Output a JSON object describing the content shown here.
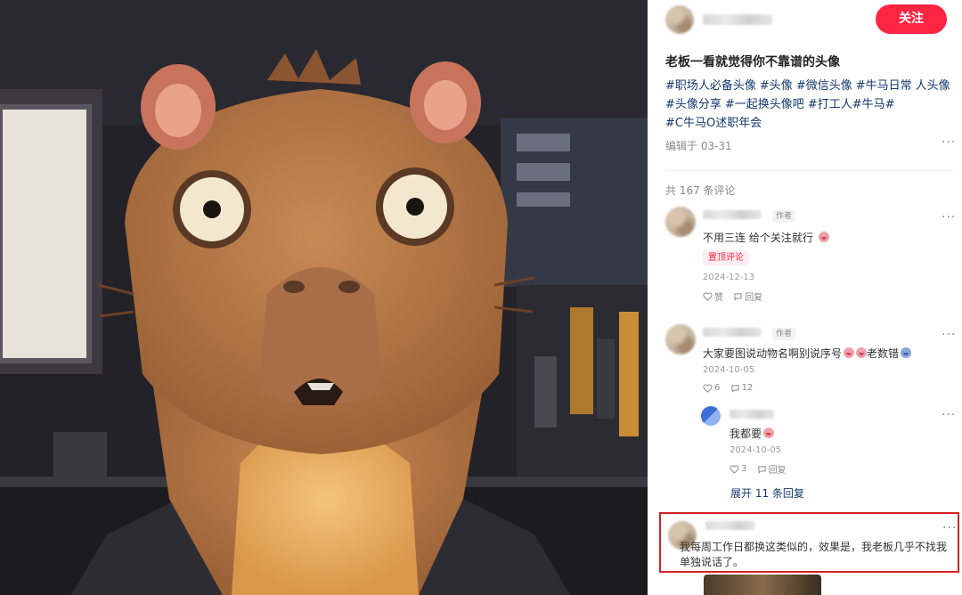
{
  "post": {
    "follow_label": "关注",
    "title": "老板一看就觉得你不靠谱的头像",
    "hashtags": [
      "#职场人必备头像",
      "#头像",
      "#微信头像",
      "#牛马日常",
      "人头像",
      "#头像分享",
      "#一起换头像吧",
      "#打工人",
      "#牛马",
      "#",
      "#C牛马O述职年会"
    ],
    "edited_at": "编辑于 03-31"
  },
  "comments": {
    "count_label": "共 167 条评论",
    "items": [
      {
        "author_tag": "作者",
        "text": "不用三连 给个关注就行",
        "pinned_label": "置顶评论",
        "date": "2024-12-13",
        "like_label": "赞",
        "reply_label": "回复"
      },
      {
        "author_tag": "作者",
        "text": "大家要图说动物名啊别说序号",
        "text_suffix": "老数错",
        "date": "2024-10-05",
        "like_count": "6",
        "reply_count": "12"
      }
    ],
    "reply": {
      "text": "我都要",
      "date": "2024-10-05",
      "like_count": "3",
      "reply_label": "回复"
    },
    "expand_label": "展开 11 条回复",
    "highlighted": {
      "text": "我每周工作日都换这类似的，效果是，我老板几乎不找我单独说话了。"
    }
  },
  "icons": {
    "more": "more-dots-icon",
    "like": "heart-icon",
    "reply": "chat-bubble-icon",
    "emoji": "emoji-icon"
  },
  "colors": {
    "accent": "#ff2442",
    "hashtag": "#13386c",
    "highlight_border": "#d52226"
  }
}
